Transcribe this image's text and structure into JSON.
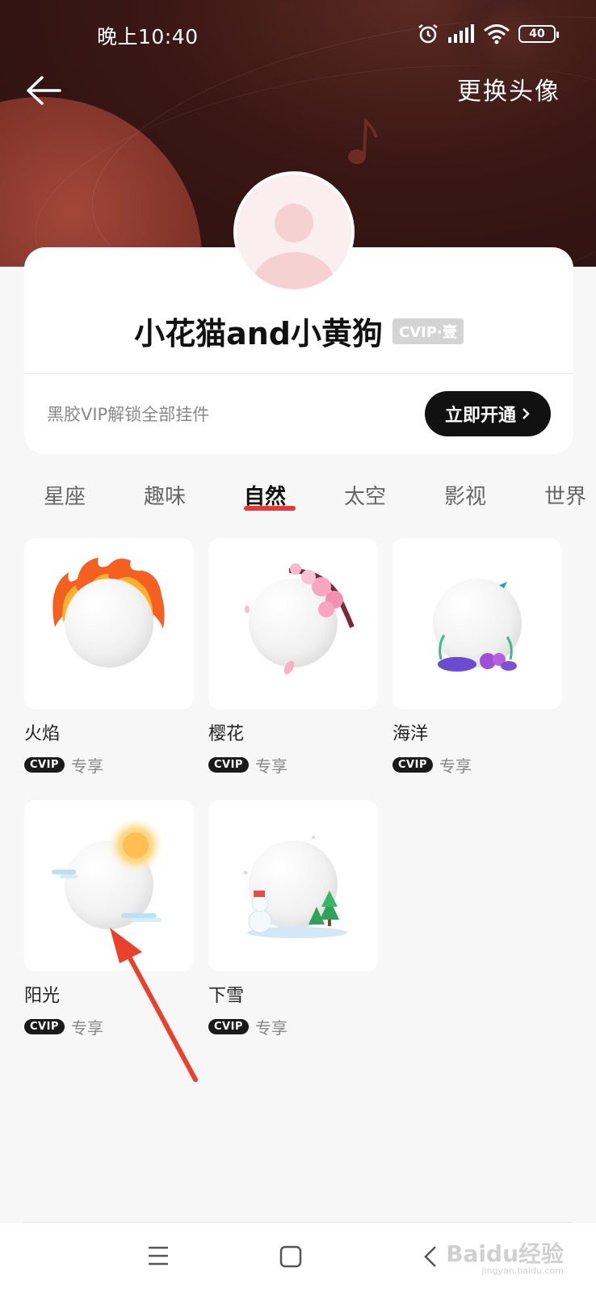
{
  "status_bar": {
    "time": "晚上10:40",
    "battery": "40"
  },
  "header": {
    "action_label": "更换头像"
  },
  "profile": {
    "username": "小花猫and小黄狗",
    "vip_badge": "CVIP·壹",
    "unlock_text": "黑胶VIP解锁全部挂件",
    "open_button": "立即开通"
  },
  "tabs": [
    {
      "label": "星座",
      "active": false
    },
    {
      "label": "趣味",
      "active": false
    },
    {
      "label": "自然",
      "active": true
    },
    {
      "label": "太空",
      "active": false
    },
    {
      "label": "影视",
      "active": false
    },
    {
      "label": "世界",
      "active": false
    }
  ],
  "items": [
    {
      "name": "火焰",
      "badge": "CVIP",
      "tag": "专享",
      "icon": "fire-frame-icon"
    },
    {
      "name": "樱花",
      "badge": "CVIP",
      "tag": "专享",
      "icon": "cherry-blossom-frame-icon"
    },
    {
      "name": "海洋",
      "badge": "CVIP",
      "tag": "专享",
      "icon": "ocean-frame-icon"
    },
    {
      "name": "阳光",
      "badge": "CVIP",
      "tag": "专享",
      "icon": "sunshine-frame-icon"
    },
    {
      "name": "下雪",
      "badge": "CVIP",
      "tag": "专享",
      "icon": "snow-frame-icon"
    }
  ],
  "watermark": {
    "text": "Baidu经验",
    "sub": "jingyan.baidu.com"
  },
  "colors": {
    "accent": "#e5393a",
    "header_bg": "#3a1714",
    "button_bg": "#111111"
  }
}
